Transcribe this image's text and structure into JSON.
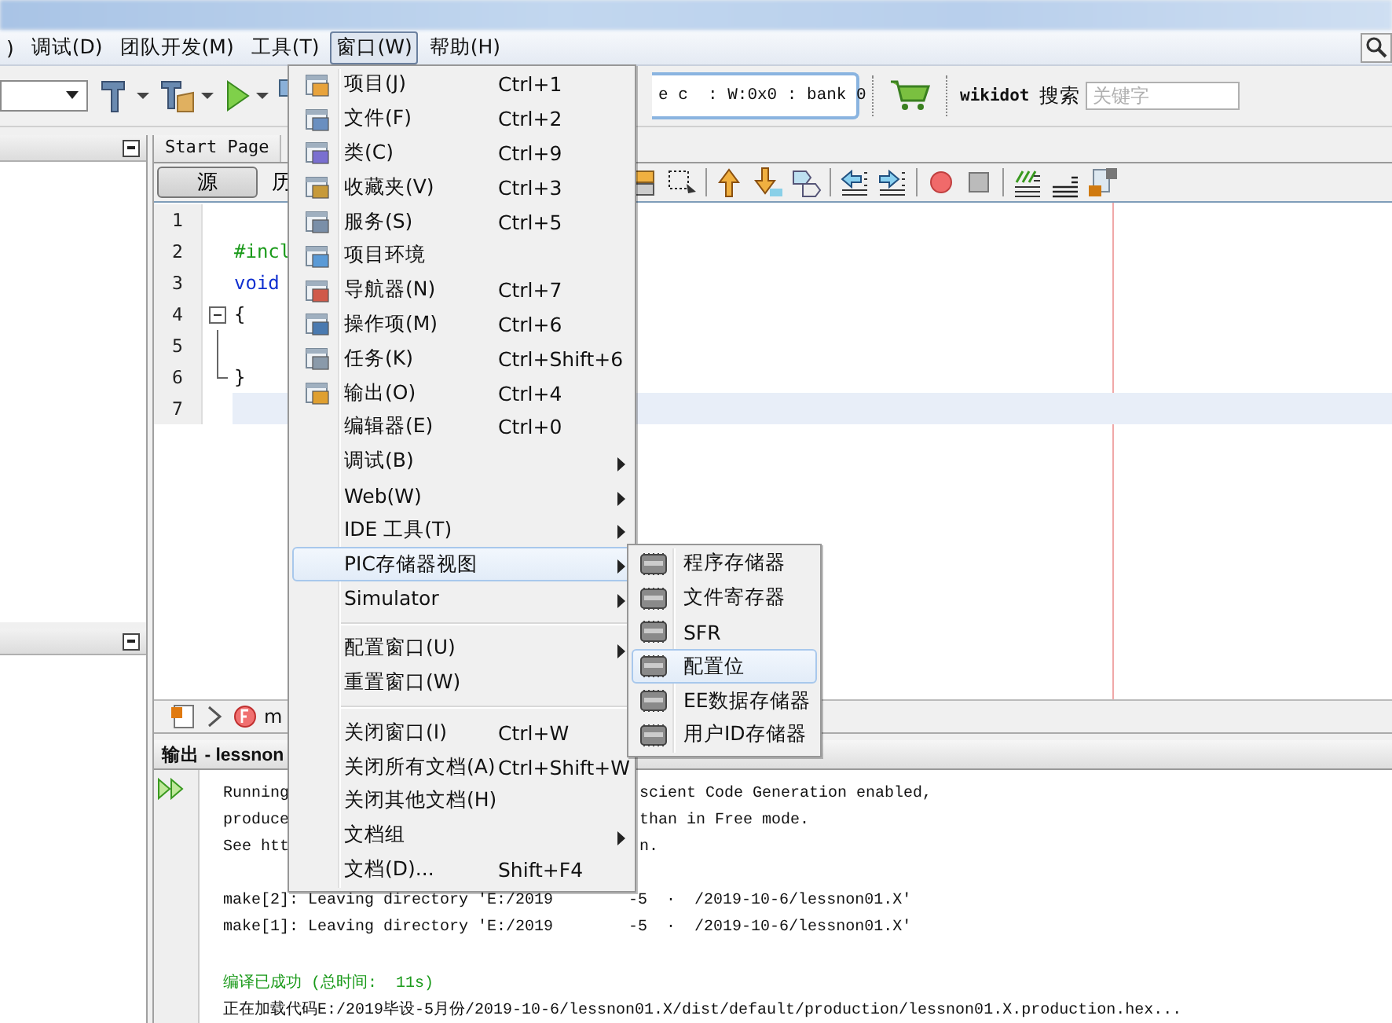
{
  "menubar": {
    "items": [
      {
        "label": ")",
        "selected": false
      },
      {
        "label": "调试(D)",
        "selected": false
      },
      {
        "label": "团队开发(M)",
        "selected": false
      },
      {
        "label": "工具(T)",
        "selected": false
      },
      {
        "label": "窗口(W)",
        "selected": true
      },
      {
        "label": "帮助(H)",
        "selected": false
      }
    ]
  },
  "toolbar": {
    "status_field": "e c  : W:0x0 : bank 0",
    "site": "wikidot",
    "search_label": "搜索",
    "search": {
      "placeholder": "关键字"
    }
  },
  "editor": {
    "tab": "Start Page",
    "view_buttons": [
      {
        "label": "源",
        "selected": true
      },
      {
        "label": "历",
        "selected": false
      }
    ],
    "lines": [
      {
        "number": "1",
        "kind": "empty",
        "current": false
      },
      {
        "number": "2",
        "code": "#incl",
        "kind": "directive",
        "current": false
      },
      {
        "number": "3",
        "code": "void",
        "kind": "keyword",
        "current": false
      },
      {
        "number": "4",
        "code": "{",
        "kind": "fold_start",
        "current": false
      },
      {
        "number": "5",
        "kind": "fold_line",
        "current": false
      },
      {
        "number": "6",
        "code": "}",
        "kind": "fold_end",
        "current": false
      },
      {
        "number": "7",
        "kind": "empty",
        "current": true
      }
    ]
  },
  "navigator": {
    "text": "m"
  },
  "output": {
    "title": "输出 - lessnon",
    "lines": [
      {
        "kind": "split",
        "left": "Running",
        "right": "scient Code Generation enabled,"
      },
      {
        "kind": "split",
        "left": "produce",
        "right": "than in Free mode."
      },
      {
        "kind": "split",
        "left": "See htt",
        "right": "n."
      },
      {
        "kind": "blank"
      },
      {
        "kind": "normal",
        "text": "make[2]: Leaving directory 'E:/2019        -5  ·  /2019-10-6/lessnon01.X'"
      },
      {
        "kind": "normal",
        "text": "make[1]: Leaving directory 'E:/2019        -5  ·  /2019-10-6/lessnon01.X'"
      },
      {
        "kind": "blank"
      },
      {
        "kind": "success",
        "text": "编译已成功 (总时间:  11s)"
      },
      {
        "kind": "normal",
        "text": "正在加载代码E:/2019毕设-5月份/2019-10-6/lessnon01.X/dist/default/production/lessnon01.X.production.hex..."
      }
    ]
  },
  "window_menu": {
    "items": [
      {
        "kind": "icon",
        "label": "项目(J)",
        "shortcut": "Ctrl+1",
        "submenu": false,
        "selected": false
      },
      {
        "kind": "icon",
        "label": "文件(F)",
        "shortcut": "Ctrl+2",
        "submenu": false,
        "selected": false
      },
      {
        "kind": "icon",
        "label": "类(C)",
        "shortcut": "Ctrl+9",
        "submenu": false,
        "selected": false
      },
      {
        "kind": "icon",
        "label": "收藏夹(V)",
        "shortcut": "Ctrl+3",
        "submenu": false,
        "selected": false
      },
      {
        "kind": "icon",
        "label": "服务(S)",
        "shortcut": "Ctrl+5",
        "submenu": false,
        "selected": false
      },
      {
        "kind": "icon",
        "label": "项目环境",
        "submenu": false,
        "selected": false
      },
      {
        "kind": "icon",
        "label": "导航器(N)",
        "shortcut": "Ctrl+7",
        "submenu": false,
        "selected": false
      },
      {
        "kind": "icon",
        "label": "操作项(M)",
        "shortcut": "Ctrl+6",
        "submenu": false,
        "selected": false
      },
      {
        "kind": "icon",
        "label": "任务(K)",
        "shortcut": "Ctrl+Shift+6",
        "submenu": false,
        "selected": false
      },
      {
        "kind": "icon",
        "label": "输出(O)",
        "shortcut": "Ctrl+4",
        "submenu": false,
        "selected": false
      },
      {
        "kind": "text",
        "label": "编辑器(E)",
        "shortcut": "Ctrl+0",
        "submenu": false,
        "selected": false
      },
      {
        "kind": "text",
        "label": "调试(B)",
        "submenu": true,
        "selected": false
      },
      {
        "kind": "text",
        "label": "Web(W)",
        "submenu": true,
        "selected": false
      },
      {
        "kind": "text",
        "label": "IDE 工具(T)",
        "submenu": true,
        "selected": false
      },
      {
        "kind": "text",
        "label": "PIC存储器视图",
        "submenu": true,
        "selected": true
      },
      {
        "kind": "text",
        "label": "Simulator",
        "submenu": true,
        "selected": false
      },
      {
        "kind": "separator"
      },
      {
        "kind": "text",
        "label": "配置窗口(U)",
        "submenu": true,
        "selected": false
      },
      {
        "kind": "text",
        "label": "重置窗口(W)",
        "submenu": false,
        "selected": false
      },
      {
        "kind": "separator"
      },
      {
        "kind": "text",
        "label": "关闭窗口(I)",
        "shortcut": "Ctrl+W",
        "submenu": false,
        "selected": false
      },
      {
        "kind": "text",
        "label": "关闭所有文档(A)",
        "shortcut": "Ctrl+Shift+W",
        "submenu": false,
        "selected": false
      },
      {
        "kind": "text",
        "label": "关闭其他文档(H)",
        "submenu": false,
        "selected": false
      },
      {
        "kind": "text",
        "label": "文档组",
        "submenu": true,
        "selected": false
      },
      {
        "kind": "text",
        "label": "文档(D)...",
        "shortcut": "Shift+F4",
        "submenu": false,
        "selected": false
      }
    ]
  },
  "memory_submenu": {
    "items": [
      {
        "label": "程序存储器",
        "selected": false
      },
      {
        "label": "文件寄存器",
        "selected": false
      },
      {
        "label": "SFR",
        "selected": false
      },
      {
        "label": "配置位",
        "selected": true
      },
      {
        "label": "EE数据存储器",
        "selected": false
      },
      {
        "label": "用户ID存储器",
        "selected": false
      }
    ]
  }
}
